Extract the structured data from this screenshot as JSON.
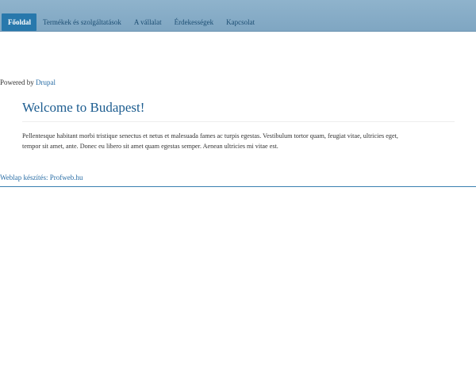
{
  "nav": {
    "items": [
      {
        "label": "Főoldal",
        "active": true
      },
      {
        "label": "Termékek és szolgáltatások",
        "active": false
      },
      {
        "label": "A vállalat",
        "active": false
      },
      {
        "label": "Érdekességek",
        "active": false
      },
      {
        "label": "Kapcsolat",
        "active": false
      }
    ]
  },
  "powered": {
    "prefix": "Powered by ",
    "link": "Drupal"
  },
  "main": {
    "title": "Welcome to Budapest!",
    "body": "Pellentesque habitant morbi tristique senectus et netus et malesuada fames ac turpis egestas. Vestibulum tortor quam, feugiat vitae, ultricies eget, tempor sit amet, ante. Donec eu libero sit amet quam egestas semper. Aenean ultricies mi vitae est."
  },
  "footer": {
    "credit": "Weblap készítés: Profweb.hu"
  },
  "colors": {
    "nav_bg": "#8fb3cc",
    "nav_active": "#2878ac",
    "link": "#2a6ea6",
    "title": "#1d5d90"
  }
}
